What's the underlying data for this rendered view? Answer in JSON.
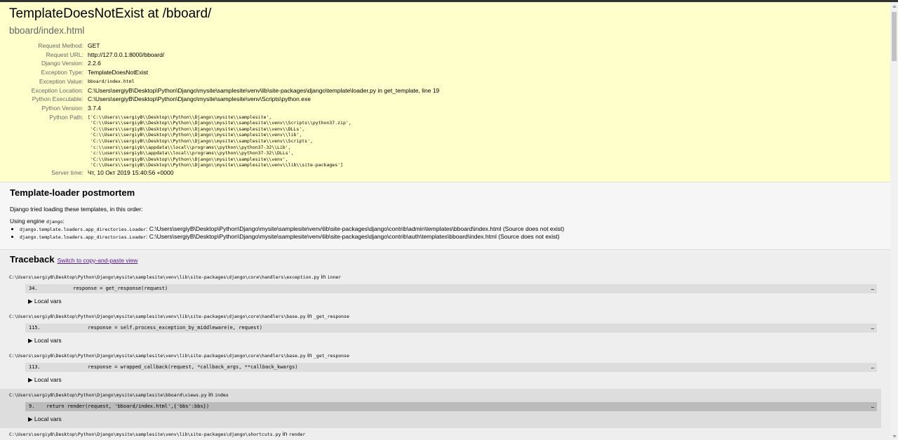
{
  "summary": {
    "title": "TemplateDoesNotExist at /bboard/",
    "subtitle": "bboard/index.html",
    "meta": [
      {
        "label": "Request Method:",
        "value": "GET"
      },
      {
        "label": "Request URL:",
        "value": "http://127.0.0.1:8000/bboard/"
      },
      {
        "label": "Django Version:",
        "value": "2.2.6"
      },
      {
        "label": "Exception Type:",
        "value": "TemplateDoesNotExist"
      },
      {
        "label": "Exception Value:",
        "value": "bboard/index.html"
      },
      {
        "label": "Exception Location:",
        "value": "C:\\Users\\sergiyB\\Desktop\\Python\\Django\\mysite\\samplesite\\venv\\lib\\site-packages\\django\\template\\loader.py in get_template, line 19"
      },
      {
        "label": "Python Executable:",
        "value": "C:\\Users\\sergiyB\\Desktop\\Python\\Django\\mysite\\samplesite\\venv\\Scripts\\python.exe"
      },
      {
        "label": "Python Version:",
        "value": "3.7.4"
      },
      {
        "label": "Python Path:",
        "value": "['C:\\\\Users\\\\sergiyB\\\\Desktop\\\\Python\\\\Django\\\\mysite\\\\samplesite',\n 'C:\\\\Users\\\\sergiyB\\\\Desktop\\\\Python\\\\Django\\\\mysite\\\\samplesite\\\\venv\\\\Scripts\\\\python37.zip',\n 'C:\\\\Users\\\\sergiyB\\\\Desktop\\\\Python\\\\Django\\\\mysite\\\\samplesite\\\\venv\\\\DLLs',\n 'C:\\\\Users\\\\sergiyB\\\\Desktop\\\\Python\\\\Django\\\\mysite\\\\samplesite\\\\venv\\\\lib',\n 'C:\\\\Users\\\\sergiyB\\\\Desktop\\\\Python\\\\Django\\\\mysite\\\\samplesite\\\\venv\\\\Scripts',\n 'c:\\\\users\\\\sergiyb\\\\appdata\\\\local\\\\programs\\\\python\\\\python37-32\\\\Lib',\n 'c:\\\\users\\\\sergiyb\\\\appdata\\\\local\\\\programs\\\\python\\\\python37-32\\\\DLLs',\n 'C:\\\\Users\\\\sergiyB\\\\Desktop\\\\Python\\\\Django\\\\mysite\\\\samplesite\\\\venv',\n 'C:\\\\Users\\\\sergiyB\\\\Desktop\\\\Python\\\\Django\\\\mysite\\\\samplesite\\\\venv\\\\lib\\\\site-packages']"
      },
      {
        "label": "Server time:",
        "value": "Чт, 10 Окт 2019 15:40:56 +0000"
      }
    ]
  },
  "postmortem": {
    "heading": "Template-loader postmortem",
    "tried": "Django tried loading these templates, in this order:",
    "engine_prefix": "Using engine",
    "engine_name": "django",
    "engine_suffix": ":",
    "items": [
      {
        "loader": "django.template.loaders.app_directories.Loader",
        "path": ": C:\\Users\\sergiyB\\Desktop\\Python\\Django\\mysite\\samplesite\\venv\\lib\\site-packages\\django\\contrib\\admin\\templates\\bboard\\index.html (Source does not exist)"
      },
      {
        "loader": "django.template.loaders.app_directories.Loader",
        "path": ": C:\\Users\\sergiyB\\Desktop\\Python\\Django\\mysite\\samplesite\\venv\\lib\\site-packages\\django\\contrib\\auth\\templates\\bboard\\index.html (Source does not exist)"
      }
    ]
  },
  "traceback": {
    "heading": "Traceback",
    "switch_link": "Switch to copy-and-paste view",
    "in_word": "in",
    "local_vars": "Local vars",
    "dots": "…",
    "frames": [
      {
        "file": "C:\\Users\\sergiyB\\Desktop\\Python\\Django\\mysite\\samplesite\\venv\\lib\\site-packages\\django\\core\\handlers\\exception.py",
        "func": "inner",
        "line": "34.",
        "code": "            response = get_response(request)"
      },
      {
        "file": "C:\\Users\\sergiyB\\Desktop\\Python\\Django\\mysite\\samplesite\\venv\\lib\\site-packages\\django\\core\\handlers\\base.py",
        "func": "_get_response",
        "line": "115.",
        "code": "                response = self.process_exception_by_middleware(e, request)"
      },
      {
        "file": "C:\\Users\\sergiyB\\Desktop\\Python\\Django\\mysite\\samplesite\\venv\\lib\\site-packages\\django\\core\\handlers\\base.py",
        "func": "_get_response",
        "line": "113.",
        "code": "                response = wrapped_callback(request, *callback_args, **callback_kwargs)"
      },
      {
        "file": "C:\\Users\\sergiyB\\Desktop\\Python\\Django\\mysite\\samplesite\\bboard\\views.py",
        "func": "index",
        "line": "9.",
        "code": "    return render(request, 'bboard/index.html',{'bbs':bbs})"
      },
      {
        "file": "C:\\Users\\sergiyB\\Desktop\\Python\\Django\\mysite\\samplesite\\venv\\lib\\site-packages\\django\\shortcuts.py",
        "func": "render",
        "line": "",
        "code": ""
      }
    ]
  }
}
